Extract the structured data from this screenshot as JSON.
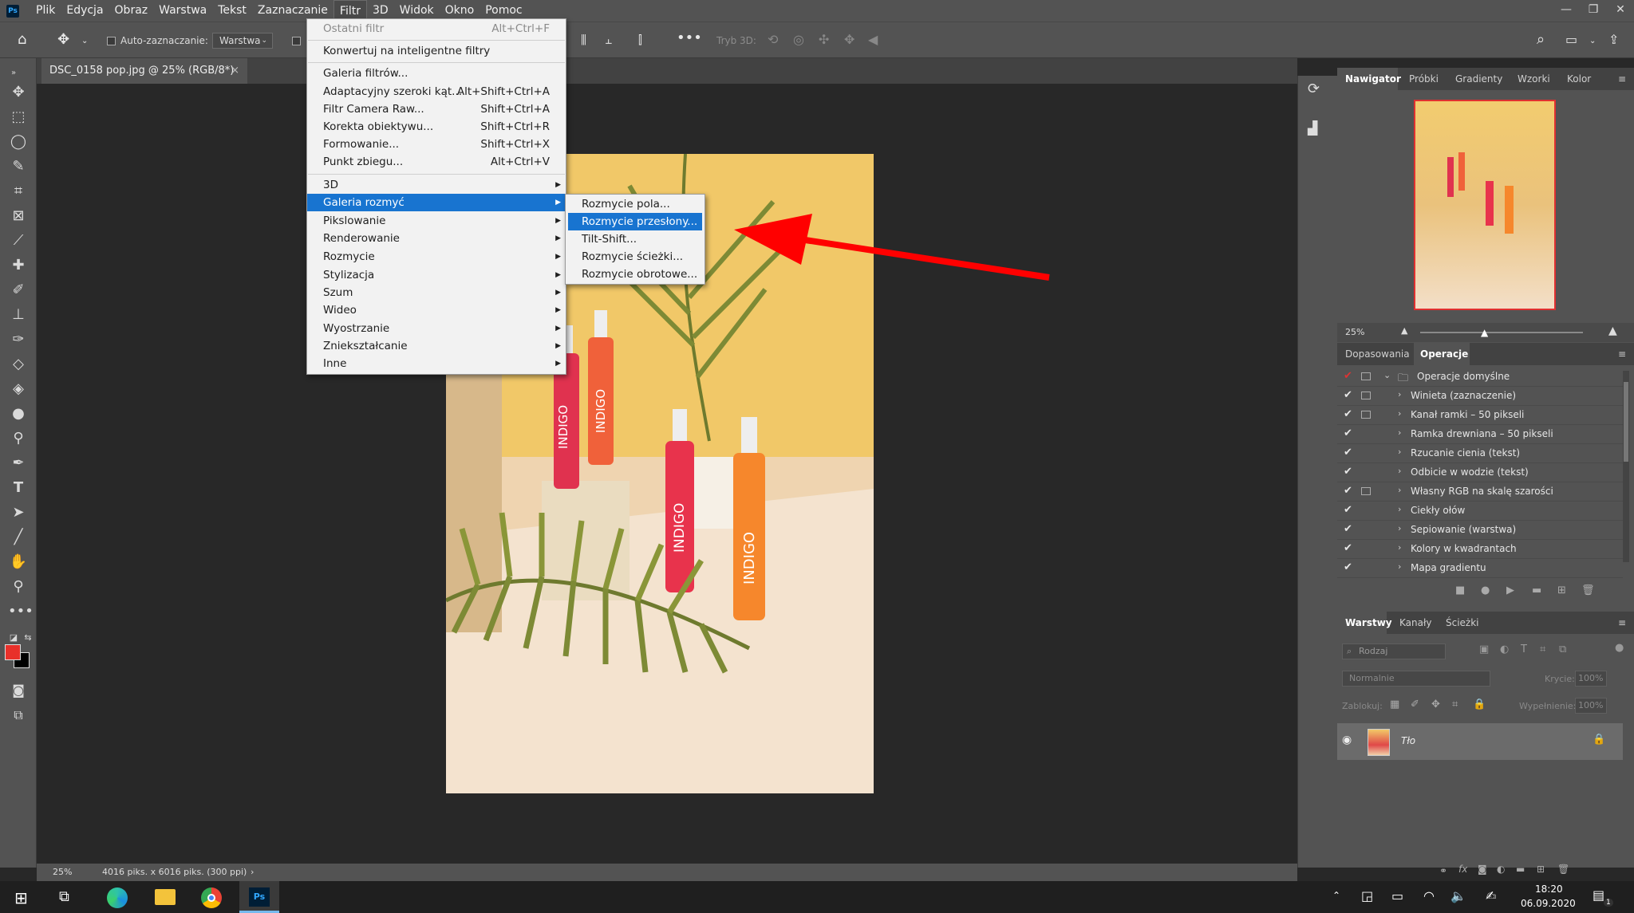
{
  "app": {
    "logo": "Ps"
  },
  "menubar": {
    "items": [
      "Plik",
      "Edycja",
      "Obraz",
      "Warstwa",
      "Tekst",
      "Zaznaczanie",
      "Filtr",
      "3D",
      "Widok",
      "Okno",
      "Pomoc"
    ],
    "active": "Filtr"
  },
  "options": {
    "auto_select_label": "Auto-zaznaczanie:",
    "auto_select_value": "Warstwa",
    "mode_3d_label": "Tryb 3D:"
  },
  "document": {
    "tab_title": "DSC_0158 pop.jpg @ 25% (RGB/8*)",
    "close": "×"
  },
  "filter_menu": {
    "items": [
      {
        "label": "Ostatni filtr",
        "shortcut": "Alt+Ctrl+F",
        "disabled": true
      },
      {
        "label": "Konwertuj na inteligentne filtry",
        "shortcut": ""
      },
      {
        "label": "Galeria filtrów...",
        "shortcut": ""
      },
      {
        "label": "Adaptacyjny szeroki kąt...",
        "shortcut": "Alt+Shift+Ctrl+A"
      },
      {
        "label": "Filtr Camera Raw...",
        "shortcut": "Shift+Ctrl+A"
      },
      {
        "label": "Korekta obiektywu...",
        "shortcut": "Shift+Ctrl+R"
      },
      {
        "label": "Formowanie...",
        "shortcut": "Shift+Ctrl+X"
      },
      {
        "label": "Punkt zbiegu...",
        "shortcut": "Alt+Ctrl+V"
      },
      {
        "label": "3D",
        "submenu": true
      },
      {
        "label": "Galeria rozmyć",
        "submenu": true,
        "highlighted": true
      },
      {
        "label": "Pikslowanie",
        "submenu": true
      },
      {
        "label": "Renderowanie",
        "submenu": true
      },
      {
        "label": "Rozmycie",
        "submenu": true
      },
      {
        "label": "Stylizacja",
        "submenu": true
      },
      {
        "label": "Szum",
        "submenu": true
      },
      {
        "label": "Wideo",
        "submenu": true
      },
      {
        "label": "Wyostrzanie",
        "submenu": true
      },
      {
        "label": "Zniekształcanie",
        "submenu": true
      },
      {
        "label": "Inne",
        "submenu": true
      }
    ]
  },
  "blur_submenu": {
    "items": [
      {
        "label": "Rozmycie pola..."
      },
      {
        "label": "Rozmycie przesłony...",
        "highlighted": true
      },
      {
        "label": "Tilt-Shift..."
      },
      {
        "label": "Rozmycie ścieżki..."
      },
      {
        "label": "Rozmycie obrotowe..."
      }
    ]
  },
  "photo": {
    "brand_text": "INDIGO"
  },
  "status": {
    "zoom": "25%",
    "info": "4016 piks. x 6016 piks. (300 ppi)",
    "arrow": "›"
  },
  "navigator": {
    "tabs": [
      "Nawigator",
      "Próbki",
      "Gradienty",
      "Wzorki",
      "Kolor"
    ],
    "active": "Nawigator",
    "zoom": "25%"
  },
  "actions": {
    "tabs": [
      "Dopasowania",
      "Operacje"
    ],
    "active": "Operacje",
    "set_name": "Operacje domyślne",
    "items": [
      {
        "label": "Winieta (zaznaczenie)",
        "dialog": true
      },
      {
        "label": "Kanał ramki – 50 pikseli",
        "dialog": true
      },
      {
        "label": "Ramka drewniana – 50 pikseli",
        "dialog": false
      },
      {
        "label": "Rzucanie cienia (tekst)",
        "dialog": false
      },
      {
        "label": "Odbicie w wodzie (tekst)",
        "dialog": false
      },
      {
        "label": "Własny RGB na skalę szarości",
        "dialog": true
      },
      {
        "label": "Ciekły ołów",
        "dialog": false
      },
      {
        "label": "Sepiowanie (warstwa)",
        "dialog": false
      },
      {
        "label": "Kolory w kwadrantach",
        "dialog": false
      },
      {
        "label": "Mapa gradientu",
        "dialog": false
      }
    ]
  },
  "layers": {
    "tabs": [
      "Warstwy",
      "Kanały",
      "Ścieżki"
    ],
    "active": "Warstwy",
    "filter_placeholder": "Rodzaj",
    "blend_mode": "Normalnie",
    "opacity_label": "Krycie:",
    "opacity_value": "100%",
    "lock_label": "Zablokuj:",
    "fill_label": "Wypełnienie:",
    "fill_value": "100%",
    "layer_name": "Tło"
  },
  "taskbar": {
    "time": "18:20",
    "date": "06.09.2020",
    "notif_count": "1"
  },
  "colors": {
    "accent": "#1874d0",
    "foreground": "#e8302a",
    "background": "#000000",
    "arrow": "#ff0000"
  }
}
